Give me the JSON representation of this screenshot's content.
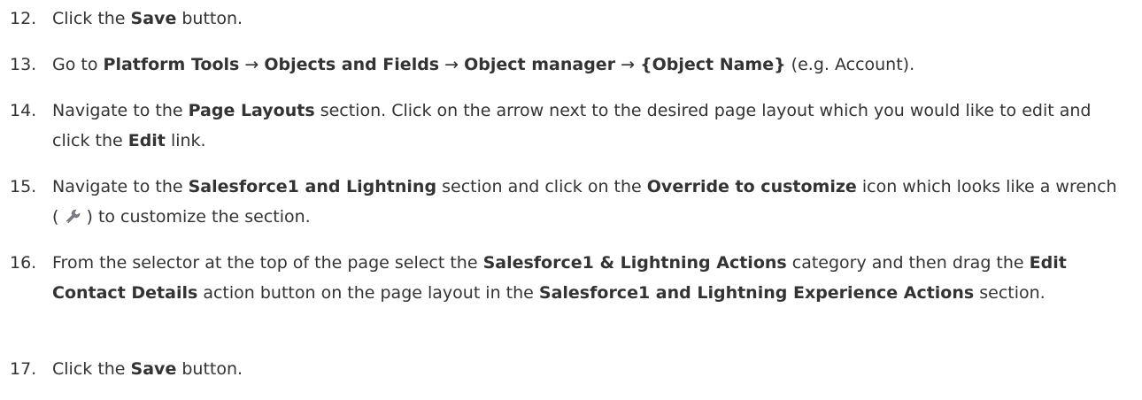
{
  "steps": [
    {
      "number": "12.",
      "parts": [
        {
          "t": "Click the "
        },
        {
          "b": "Save"
        },
        {
          "t": " button."
        }
      ]
    },
    {
      "number": "13.",
      "parts": [
        {
          "t": "Go to "
        },
        {
          "b": "Platform Tools"
        },
        {
          "t": " → "
        },
        {
          "b": "Objects and Fields"
        },
        {
          "t": " → "
        },
        {
          "b": "Object manager"
        },
        {
          "t": " →  "
        },
        {
          "b": "{Object Name}"
        },
        {
          "t": " (e.g. Account)."
        }
      ]
    },
    {
      "number": "14.",
      "parts": [
        {
          "t": "Navigate to the "
        },
        {
          "b": "Page Layouts"
        },
        {
          "t": " section. Click on the arrow next to the desired page layout which you would like to edit and click the "
        },
        {
          "b": "Edit"
        },
        {
          "t": " link."
        }
      ]
    },
    {
      "number": "15.",
      "parts": [
        {
          "t": "Navigate to the "
        },
        {
          "b": "Salesforce1 and Lightning"
        },
        {
          "t": " section and click on the "
        },
        {
          "b": "Override to customize"
        },
        {
          "t": " icon which looks like a wrench ( "
        },
        {
          "icon": "wrench-icon"
        },
        {
          "t": " ) to customize the section."
        }
      ]
    },
    {
      "number": "16.",
      "parts": [
        {
          "t": "From the selector at the top of the page select the "
        },
        {
          "b": "Salesforce1 & Lightning Actions"
        },
        {
          "t": " category and then drag the "
        },
        {
          "b": "Edit Contact Details"
        },
        {
          "t": " action button on the page layout in the "
        },
        {
          "b": "Salesforce1 and Lightning Experience Actions"
        },
        {
          "t": " section."
        }
      ]
    },
    {
      "number": "17.",
      "parts": [
        {
          "t": "Click the "
        },
        {
          "b": "Save"
        },
        {
          "t": " button."
        }
      ]
    }
  ]
}
